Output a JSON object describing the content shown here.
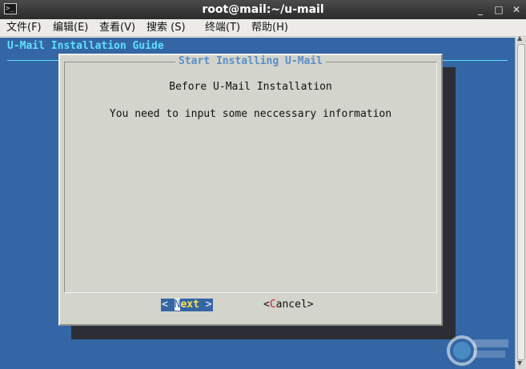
{
  "window": {
    "title": "root@mail:~/u-mail",
    "icon": "terminal-icon",
    "controls": {
      "minimize": "_",
      "maximize": "□",
      "close": "✕"
    }
  },
  "menubar": {
    "file": "文件(F)",
    "edit": "编辑(E)",
    "view": "查看(V)",
    "search": "搜索 (S)",
    "terminal": "终端(T)",
    "help": "帮助(H)"
  },
  "terminal": {
    "backtitle": "U-Mail Installation Guide",
    "dialog": {
      "title": "Start Installing U-Mail",
      "heading": "Before U-Mail Installation",
      "message": "You need to input some neccessary information",
      "next_button": {
        "open": "< ",
        "hotkey": "N",
        "rest": "ext",
        "close": " >"
      },
      "cancel_button": {
        "open": "<",
        "hotkey": "C",
        "rest": "ancel",
        "close": ">"
      }
    }
  },
  "colors": {
    "terminal_bg": "#3466a5",
    "backtitle": "#5fe0ff",
    "dialog_bg": "#d3d4cc",
    "dialog_title": "#5b8ec7",
    "hotkey_red": "#c4262d",
    "next_text": "#ffe14a"
  }
}
